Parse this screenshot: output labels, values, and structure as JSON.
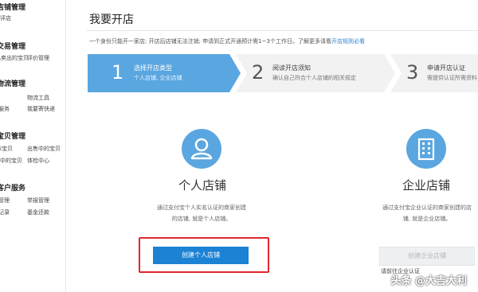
{
  "sidebar": {
    "sections": [
      {
        "title": "店铺管理",
        "links": [
          "评店"
        ]
      },
      {
        "title": "交易管理",
        "links": [
          "已卖出的宝贝",
          "评价管理"
        ]
      },
      {
        "title": "物流管理",
        "links": [
          "物流工具",
          "服务",
          "我要寄快递"
        ]
      },
      {
        "title": "宝贝管理",
        "links": [
          "发布宝贝",
          "出售中的宝贝",
          "仓库中的宝贝",
          "体检中心"
        ]
      },
      {
        "title": "客户服务",
        "links": [
          "管理",
          "举报管理",
          "记录",
          "基金还款"
        ]
      }
    ]
  },
  "main": {
    "title": "我要开店",
    "notice_text": "一个身份只能开一家店; 开店后店铺无法注销; 申请到正式开通预计需1~3个工作日。了解更多请看",
    "notice_link": "开店规则必看"
  },
  "steps": [
    {
      "number": "1",
      "title": "选择开店类型",
      "desc": "个人店铺, 企业店铺",
      "active": true
    },
    {
      "number": "2",
      "title": "阅读开店须知",
      "desc": "确认自己符合个人店铺的相关规定",
      "active": false
    },
    {
      "number": "3",
      "title": "申请开店认证",
      "desc": "需提供认证所需资料",
      "active": false
    }
  ],
  "cards": {
    "personal": {
      "title": "个人店铺",
      "desc_line1": "通过支付宝个人实名认证的商家创建",
      "desc_line2": "的店铺, 就是个人店铺。",
      "button": "创建个人店铺",
      "icon": "person-icon"
    },
    "enterprise": {
      "title": "企业店铺",
      "desc_line1": "通过支付宝企业认证的商家创建的店",
      "desc_line2": "铺, 就是企业店铺。",
      "button": "创建企业店铺",
      "icon": "building-icon",
      "note": "请前往企业认证"
    }
  },
  "watermark": "头条 @大吉大利",
  "colors": {
    "accent": "#1c82d4",
    "step_active": "#5aa6e0",
    "step_inactive": "#f2f2f2",
    "highlight": "#e0272f"
  }
}
